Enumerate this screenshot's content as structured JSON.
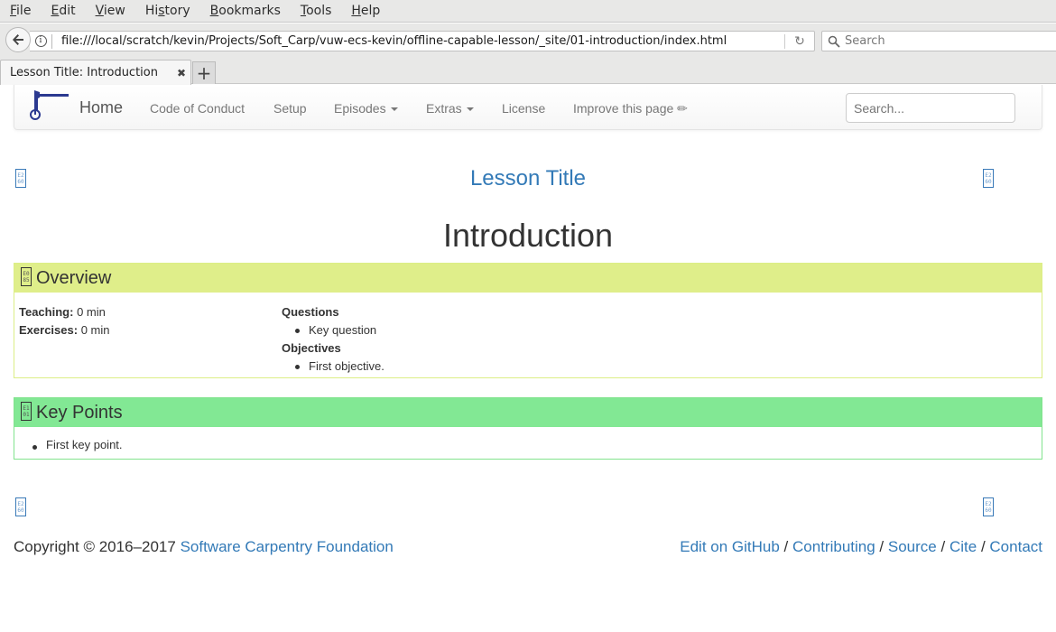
{
  "browser": {
    "menu": [
      {
        "label": "File",
        "accel": "F"
      },
      {
        "label": "Edit",
        "accel": "E"
      },
      {
        "label": "View",
        "accel": "V"
      },
      {
        "label": "History",
        "accel": "s"
      },
      {
        "label": "Bookmarks",
        "accel": "B"
      },
      {
        "label": "Tools",
        "accel": "T"
      },
      {
        "label": "Help",
        "accel": "H"
      }
    ],
    "url": "file:///local/scratch/kevin/Projects/Soft_Carp/vuw-ecs-kevin/offline-capable-lesson/_site/01-introduction/index.html",
    "search_placeholder": "Search",
    "tab_title": "Lesson Title: Introduction",
    "tab_close": "✖",
    "new_tab": "+"
  },
  "site_nav": {
    "home": "Home",
    "items": [
      {
        "label": "Code of Conduct",
        "dropdown": false
      },
      {
        "label": "Setup",
        "dropdown": false
      },
      {
        "label": "Episodes",
        "dropdown": true
      },
      {
        "label": "Extras",
        "dropdown": true
      },
      {
        "label": "License",
        "dropdown": false
      },
      {
        "label": "Improve this page ✏",
        "dropdown": false
      }
    ],
    "search_placeholder": "Search..."
  },
  "nav_glyphs": {
    "prev": "E2 60",
    "next": "E2 60",
    "overview": "E0 85",
    "keypoints": "E1 01"
  },
  "lesson_title": "Lesson Title",
  "page_title": "Introduction",
  "overview": {
    "title": "Overview",
    "teaching_label": "Teaching:",
    "teaching_value": "0 min",
    "exercises_label": "Exercises:",
    "exercises_value": "0 min",
    "questions_label": "Questions",
    "questions": [
      "Key question"
    ],
    "objectives_label": "Objectives",
    "objectives": [
      "First objective."
    ]
  },
  "keypoints": {
    "title": "Key Points",
    "items": [
      "First key point."
    ]
  },
  "footer": {
    "copyright": "Copyright © 2016–2017",
    "foundation": "Software Carpentry Foundation",
    "links": [
      "Edit on GitHub",
      "Contributing",
      "Source",
      "Cite",
      "Contact"
    ],
    "separator": "/"
  },
  "colors": {
    "link": "#337ab7",
    "overview_header": "#dfee8a",
    "keypoints_header": "#82e894",
    "logo": "#2b3990"
  }
}
